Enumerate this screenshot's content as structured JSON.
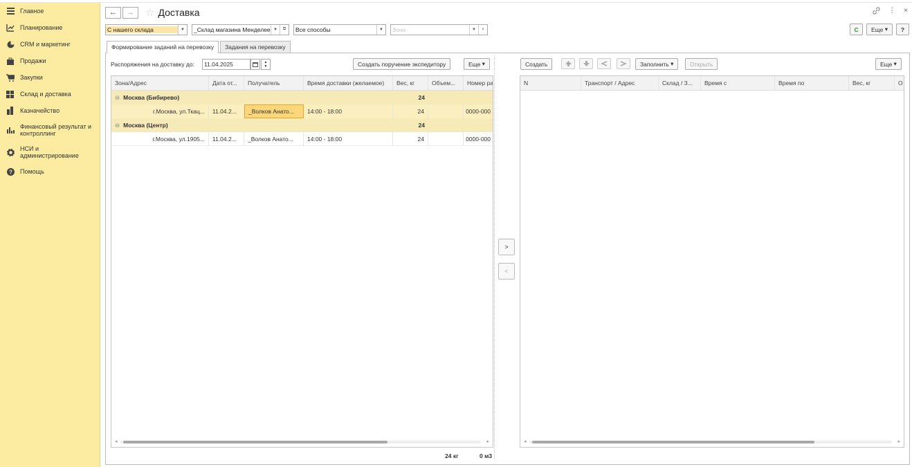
{
  "sidebar": {
    "items": [
      {
        "label": "Главное",
        "icon": "menu-icon"
      },
      {
        "label": "Планирование",
        "icon": "planning-icon"
      },
      {
        "label": "CRM и маркетинг",
        "icon": "crm-icon"
      },
      {
        "label": "Продажи",
        "icon": "bag-icon"
      },
      {
        "label": "Закупки",
        "icon": "cart-icon"
      },
      {
        "label": "Склад и доставка",
        "icon": "warehouse-icon"
      },
      {
        "label": "Казначейство",
        "icon": "treasury-icon"
      },
      {
        "label": "Финансовый результат и контроллинг",
        "icon": "chart-icon"
      },
      {
        "label": "НСИ и администрирование",
        "icon": "gear-icon"
      },
      {
        "label": "Помощь",
        "icon": "help-icon"
      }
    ]
  },
  "header": {
    "title": "Доставка",
    "back": "←",
    "forward": "→",
    "star": "☆",
    "link_icon": "🔗",
    "more_icon": "⋮",
    "close_icon": "×"
  },
  "filters": {
    "source": "С нашего склада",
    "warehouse": "_Склад магазина Менделеева",
    "method": "Все способы",
    "zone_placeholder": "Зона"
  },
  "toolbar_right": {
    "refresh": "C",
    "more": "Еще",
    "help": "?"
  },
  "tabs": [
    {
      "label": "Формирование заданий на перевозку"
    },
    {
      "label": "Задания на перевозку"
    }
  ],
  "left": {
    "date_label": "Распоряжения на доставку до:",
    "date_value": "11.04.2025",
    "create_btn": "Создать поручение экспедитору",
    "more_btn": "Еще",
    "columns": [
      "Зона/Адрес",
      "Дата от...",
      "Получатель",
      "Время доставки (желаемое)",
      "Вес, кг",
      "Объем...",
      "Номер ра"
    ],
    "groups": [
      {
        "name": "Москва (Бибирево)",
        "weight": "24",
        "row": {
          "address": "г.Москва, ул.Ткац...",
          "date": "11.04.2...",
          "recipient": "_Волков Анато...",
          "time": "14:00 - 18:00",
          "weight": "24",
          "volume": "",
          "number": "0000-000"
        }
      },
      {
        "name": "Москва (Центр)",
        "weight": "24",
        "row": {
          "address": "г.Москва, ул.1905...",
          "date": "11.04.2...",
          "recipient": "_Волков Анато...",
          "time": "14:00 - 18:00",
          "weight": "24",
          "volume": "",
          "number": "0000-000"
        }
      }
    ],
    "total_weight": "24 кг",
    "total_volume": "0 м3"
  },
  "middle": {
    "add": ">",
    "remove": "<"
  },
  "right": {
    "create_btn": "Создать",
    "fill_btn": "Заполнить",
    "open_btn": "Открыть",
    "more_btn": "Еще",
    "columns": [
      "N",
      "Транспорт / Адрес",
      "Склад / З...",
      "Время с",
      "Время по",
      "Вес, кг",
      "О"
    ]
  }
}
